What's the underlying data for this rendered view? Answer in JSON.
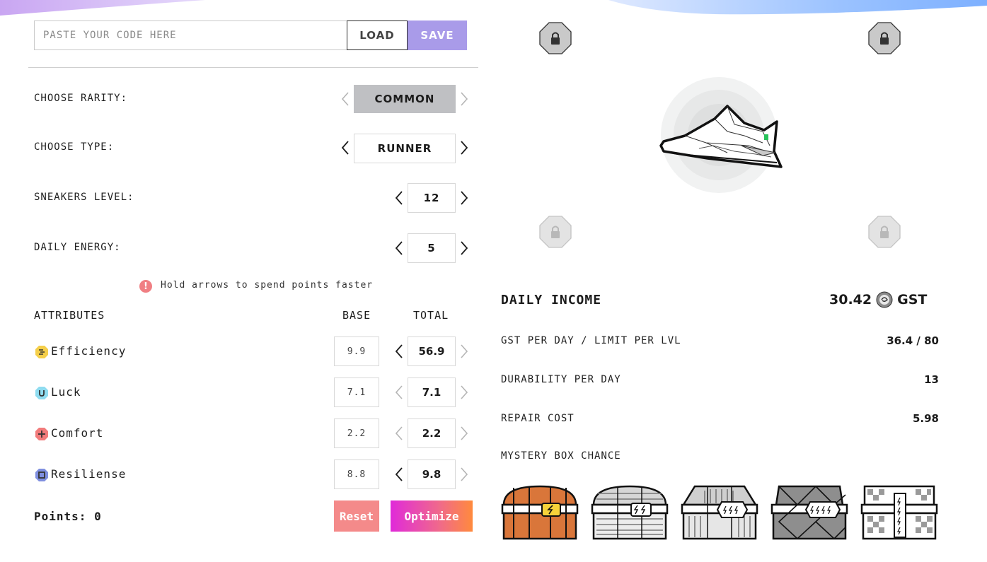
{
  "code_bar": {
    "placeholder": "PASTE YOUR CODE HERE",
    "load_label": "LOAD",
    "save_label": "SAVE"
  },
  "settings": {
    "rarity": {
      "label": "CHOOSE RARITY:",
      "value": "COMMON"
    },
    "type": {
      "label": "CHOOSE TYPE:",
      "value": "RUNNER"
    },
    "level": {
      "label": "SNEAKERS LEVEL:",
      "value": "12"
    },
    "energy": {
      "label": "DAILY ENERGY:",
      "value": "5"
    }
  },
  "hint": {
    "icon": "exclamation-icon",
    "text": "Hold arrows to spend points faster"
  },
  "attributes": {
    "header": {
      "name": "ATTRIBUTES",
      "base": "BASE",
      "total": "TOTAL"
    },
    "items": [
      {
        "name": "Efficiency",
        "icon": "efficiency-icon",
        "color": "#f5cf4a",
        "base": "9.9",
        "total": "56.9"
      },
      {
        "name": "Luck",
        "icon": "luck-icon",
        "color": "#8fdcf0",
        "base": "7.1",
        "total": "7.1"
      },
      {
        "name": "Comfort",
        "icon": "comfort-icon",
        "color": "#f27b7b",
        "base": "2.2",
        "total": "2.2"
      },
      {
        "name": "Resiliense",
        "icon": "resilience-icon",
        "color": "#7f8fe0",
        "base": "8.8",
        "total": "9.8"
      }
    ]
  },
  "points": {
    "text": "Points: 0"
  },
  "actions": {
    "reset_label": "Reset",
    "optimize_label": "Optimize"
  },
  "income": {
    "title": "DAILY INCOME",
    "value": "30.42",
    "currency": "GST",
    "stats": [
      {
        "label": "GST PER DAY / LIMIT PER LVL",
        "value": "36.4 / 80"
      },
      {
        "label": "DURABILITY PER DAY",
        "value": "13"
      },
      {
        "label": "REPAIR COST",
        "value": "5.98"
      }
    ],
    "mystery_label": "MYSTERY BOX CHANCE"
  },
  "boxes": [
    {
      "name": "common-box",
      "accent": "#d9763a",
      "bolts": 1
    },
    {
      "name": "uncommon-box",
      "accent": "#cfcfcf",
      "bolts": 2
    },
    {
      "name": "rare-box",
      "accent": "#b8b8b8",
      "bolts": 3
    },
    {
      "name": "epic-box",
      "accent": "#8a8a8a",
      "bolts": 4
    },
    {
      "name": "legendary-box",
      "accent": "#a0a0a0",
      "bolts": 5
    }
  ],
  "colors": {
    "save": "#a99be9",
    "reset": "#f48a8a",
    "rarity_bg": "#bfc0c3"
  }
}
